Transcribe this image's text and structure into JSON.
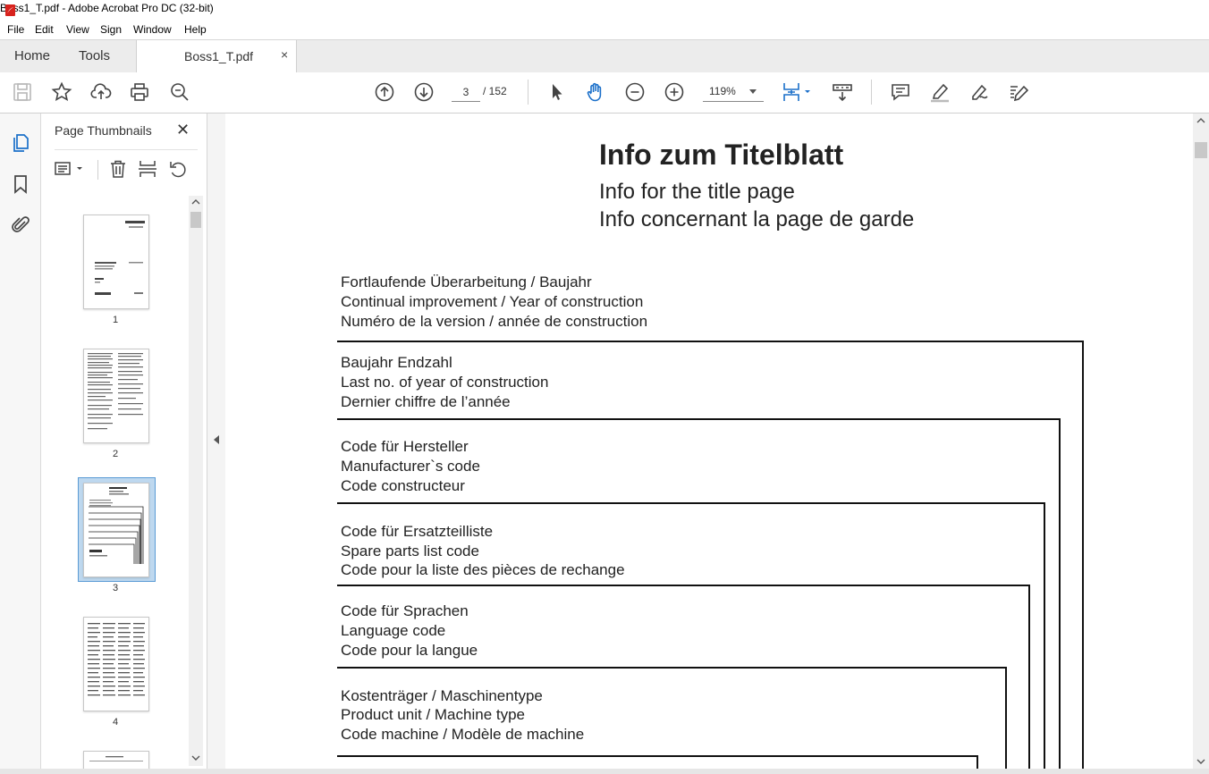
{
  "window": {
    "title": "Boss1_T.pdf - Adobe Acrobat Pro DC (32-bit)"
  },
  "menu": [
    "File",
    "Edit",
    "View",
    "Sign",
    "Window",
    "Help"
  ],
  "tabs": {
    "home": "Home",
    "tools": "Tools",
    "document": "Boss1_T.pdf",
    "close": "×"
  },
  "toolbar": {
    "current_page": "3",
    "total_pages": "/ 152",
    "zoom": "119%",
    "icons": [
      "save-icon",
      "bookmark-star-icon",
      "upload-icon",
      "print-icon",
      "zoom-search-icon",
      "page-up-icon",
      "page-down-icon",
      "select-pointer-icon",
      "hand-icon",
      "zoom-out-icon",
      "zoom-in-icon",
      "fit-page-icon",
      "scroll-mode-icon",
      "comment-icon",
      "highlight-icon",
      "sign-icon",
      "edit-icon"
    ]
  },
  "left_rail": {
    "icons": [
      "page-thumbnails-icon",
      "bookmarks-icon",
      "attachments-icon"
    ]
  },
  "thumbnails_panel": {
    "title": "Page Thumbnails",
    "close": "✕",
    "page_numbers": [
      "1",
      "2",
      "3",
      "4"
    ],
    "selected_page": "3"
  },
  "document": {
    "heading": "Info  zum  Titelblatt",
    "subheading_en": "Info for the title page",
    "subheading_fr": "Info concernant la page de garde",
    "fields": [
      {
        "de": "Fortlaufende Überarbeitung / Baujahr",
        "en": "Continual improvement / Year of construction",
        "fr": "Numéro de la version / année de construction"
      },
      {
        "de": "Baujahr Endzahl",
        "en": "Last no. of year of construction",
        "fr": "Dernier chiffre de l’année"
      },
      {
        "de": "Code für Hersteller",
        "en": "Manufacturer`s  code",
        "fr": "Code constructeur"
      },
      {
        "de": "Code für Ersatzteilliste",
        "en": "Spare parts list code",
        "fr": "Code pour la liste des pièces de rechange"
      },
      {
        "de": "Code für Sprachen",
        "en": "Language code",
        "fr": "Code pour la langue"
      },
      {
        "de": "Kostenträger / Maschinentype",
        "en": "Product unit / Machine type",
        "fr": "Code machine / Modèle de machine"
      }
    ]
  }
}
